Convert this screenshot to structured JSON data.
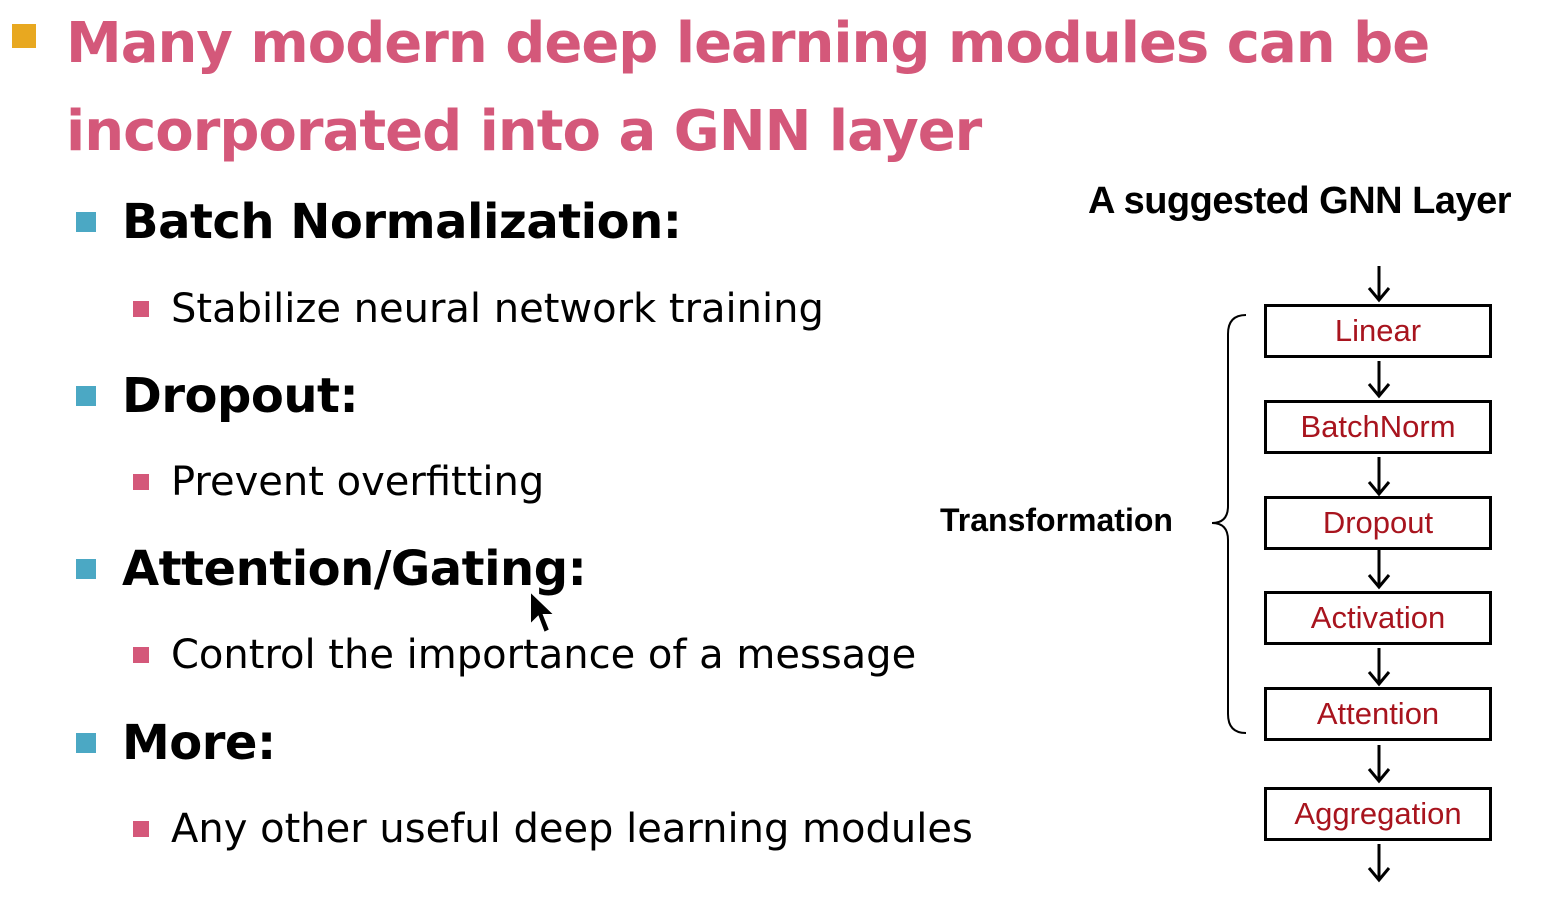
{
  "slide": {
    "title": "Many modern deep learning modules can be incorporated into a GNN layer",
    "bullets": [
      {
        "heading": "Batch Normalization:",
        "detail": "Stabilize neural network training"
      },
      {
        "heading": "Dropout:",
        "detail": "Prevent overfitting"
      },
      {
        "heading": "Attention/Gating:",
        "detail": "Control the importance of a message"
      },
      {
        "heading": "More:",
        "detail": "Any other useful deep learning modules"
      }
    ]
  },
  "diagram": {
    "title": "A suggested GNN Layer",
    "brace_label": "Transformation",
    "boxes": [
      "Linear",
      "BatchNorm",
      "Dropout",
      "Activation",
      "Attention",
      "Aggregation"
    ]
  },
  "colors": {
    "title": "#d4587a",
    "level1_bullet": "#e8a820",
    "level2_bullet": "#4ba8c4",
    "level3_bullet": "#d4587a",
    "box_text": "#a8141e"
  },
  "icons": {
    "cursor": "mouse-pointer-icon"
  }
}
